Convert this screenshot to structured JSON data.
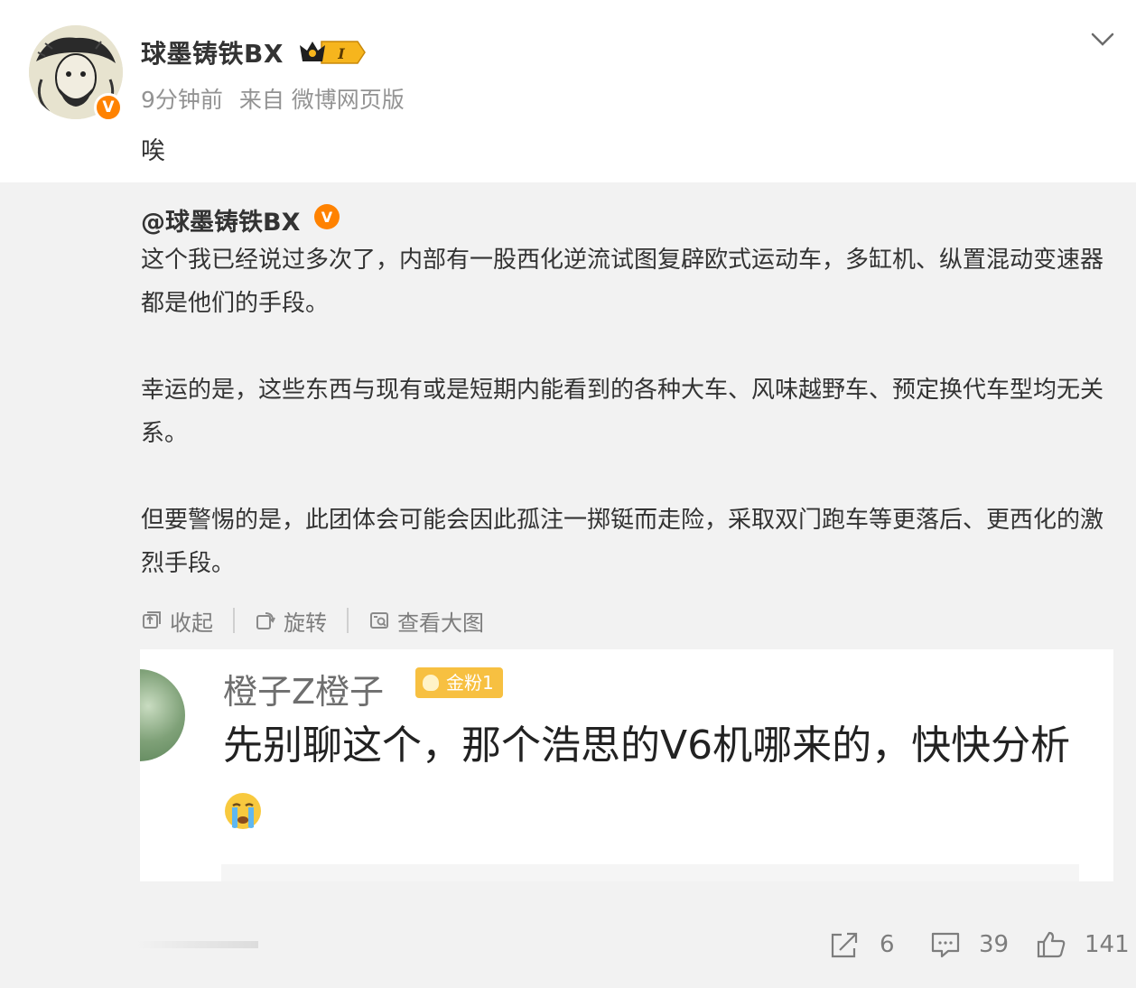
{
  "post": {
    "author": "球墨铸铁BX",
    "verified_badge": "V",
    "rank_badge": "I",
    "time": "9分钟前",
    "source": "来自 微博网页版",
    "text": "唉"
  },
  "repost": {
    "author": "@球墨铸铁BX",
    "verified_badge": "V",
    "paragraphs": [
      "这个我已经说过多次了，内部有一股西化逆流试图复辟欧式运动车，多缸机、纵置混动变速器都是他们的手段。",
      "幸运的是，这些东西与现有或是短期内能看到的各种大车、风味越野车、预定换代车型均无关系。",
      "但要警惕的是，此团体会可能会因此孤注一掷铤而走险，采取双门跑车等更落后、更西化的激烈手段。"
    ],
    "image_toolbar": {
      "collapse": "收起",
      "rotate": "旋转",
      "view_large": "查看大图"
    },
    "image": {
      "commenter_name": "橙子Z橙子",
      "fan_badge": "金粉1",
      "comment_text": "先别聊这个，那个浩思的V6机哪来的，快快分析"
    }
  },
  "actions": {
    "repost_count": "6",
    "comment_count": "39",
    "like_count": "141"
  },
  "icons": [
    "chevron-down-icon",
    "collapse-icon",
    "rotate-icon",
    "view-large-icon",
    "repost-icon",
    "comment-icon",
    "like-icon",
    "crying-emoji-icon"
  ],
  "colors": {
    "accent_orange": "#ff8200",
    "muted_text": "#939393",
    "repost_bg": "#f2f2f2",
    "fan_badge_gold": "#f7c041"
  }
}
